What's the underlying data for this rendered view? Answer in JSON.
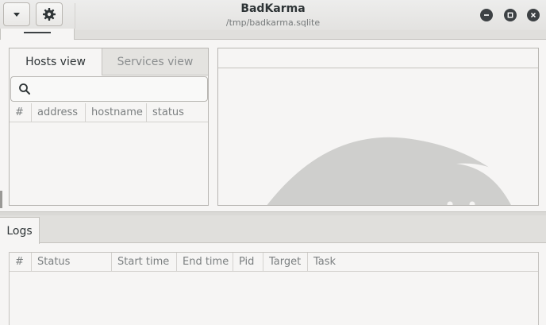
{
  "window": {
    "title": "BadKarma",
    "subtitle": "/tmp/badkarma.sqlite"
  },
  "header_buttons": {
    "menu_icon": "chevron-down-icon",
    "settings_icon": "gear-icon"
  },
  "window_controls": [
    "minimize-icon",
    "maximize-icon",
    "close-icon"
  ],
  "hosts_panel": {
    "tabs": [
      {
        "label": "Hosts view",
        "active": true
      },
      {
        "label": "Services view",
        "active": false
      }
    ],
    "search": {
      "value": "",
      "placeholder": ""
    },
    "columns": [
      "#",
      "address",
      "hostname",
      "status"
    ]
  },
  "logs_panel": {
    "tab_label": "Logs",
    "columns": [
      "#",
      "Status",
      "Start time",
      "End time",
      "Pid",
      "Target",
      "Task"
    ]
  },
  "colors": {
    "watermark": "#cfcfcd",
    "window_control": "#3d4144"
  }
}
